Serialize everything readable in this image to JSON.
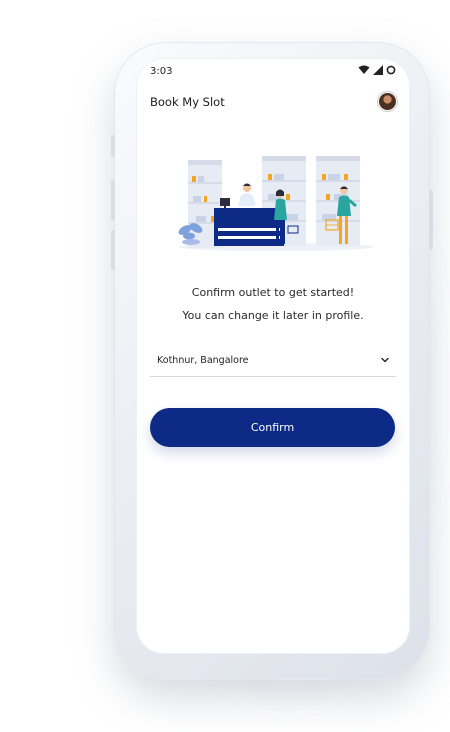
{
  "status_bar": {
    "time": "3:03"
  },
  "app_bar": {
    "title": "Book My Slot",
    "avatar_icon": "user-avatar"
  },
  "illustration": {
    "icon": "pharmacy-store-illustration"
  },
  "messages": {
    "line1": "Confirm outlet to get started!",
    "line2": "You can change it later in profile."
  },
  "outlet_select": {
    "selected": "Kothnur, Bangalore",
    "icon": "chevron-down-icon"
  },
  "confirm_button": {
    "label": "Confirm"
  },
  "colors": {
    "primary": "#0c2a86",
    "illustration_accent": "#f4a623",
    "illustration_teal": "#2aa6a0"
  }
}
